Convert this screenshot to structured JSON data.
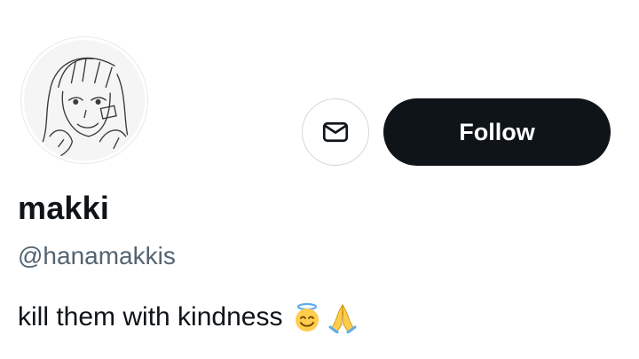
{
  "profile": {
    "display_name": "makki",
    "handle": "@hanamakkis",
    "bio_text": "kill them with kindness",
    "bio_emojis": [
      "smiling-face-with-halo",
      "folded-hands"
    ]
  },
  "actions": {
    "follow_label": "Follow",
    "message_icon": "envelope-icon"
  },
  "colors": {
    "follow_bg": "#0f1419",
    "follow_text": "#ffffff",
    "primary_text": "#0f1419",
    "secondary_text": "#536471",
    "border": "#cfd9de"
  }
}
